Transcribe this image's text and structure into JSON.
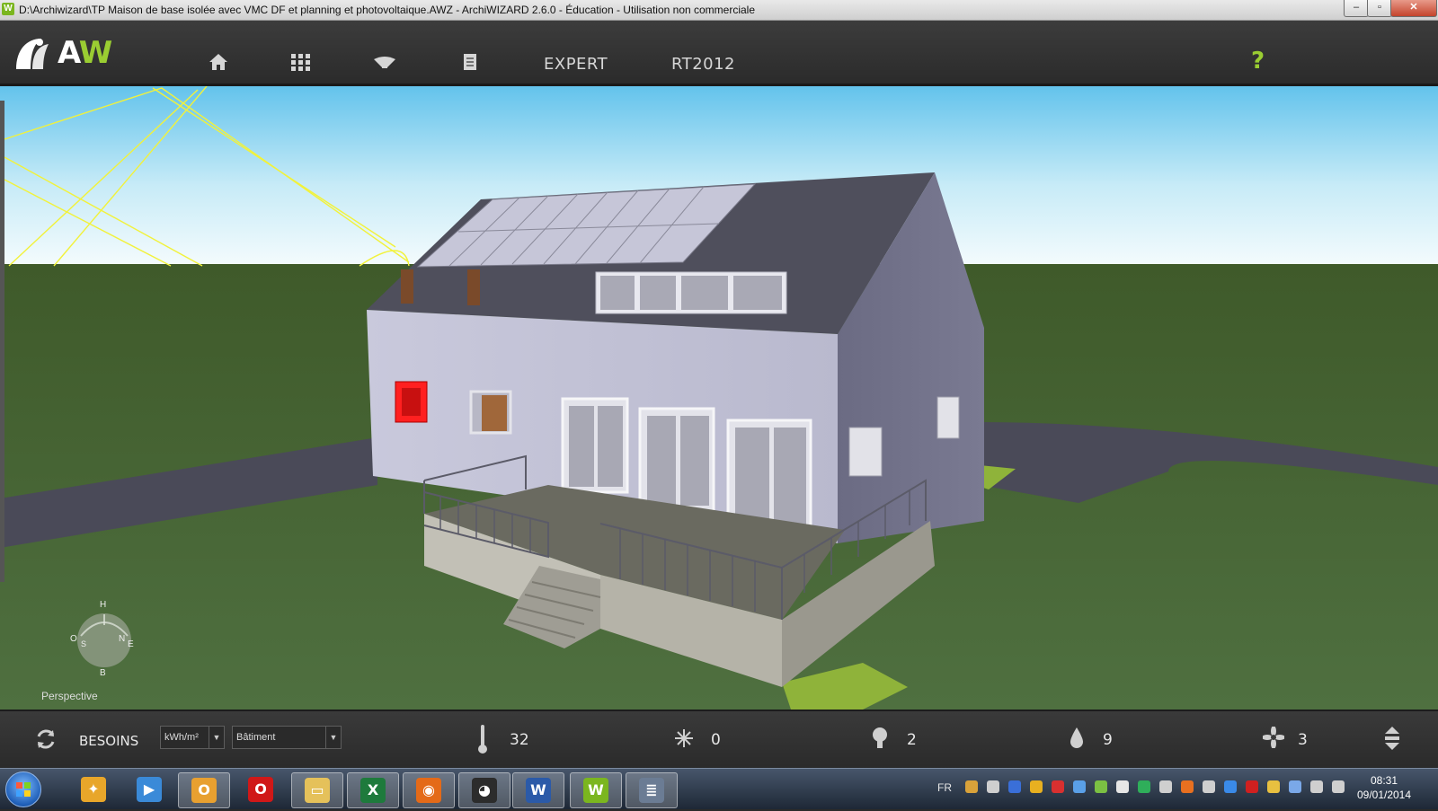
{
  "window": {
    "app_icon_letter": "W",
    "title": "D:\\Archiwizard\\TP Maison de base isolée avec VMC DF et planning et photovoltaique.AWZ  -  ArchiWIZARD 2.6.0 - Éducation - Utilisation non commerciale",
    "minimize": "–",
    "maximize": "▫",
    "close": "✕"
  },
  "header": {
    "logo_text_a": "A",
    "logo_text_w": "W",
    "nav": [
      {
        "name": "home-icon"
      },
      {
        "name": "grid-icon"
      },
      {
        "name": "view-icon"
      },
      {
        "name": "document-icon"
      }
    ],
    "expert_label": "EXPERT",
    "rt2012_label": "RT2012",
    "help_label": "?",
    "accent_color": "#9acd32"
  },
  "viewport": {
    "compass": {
      "top": "H",
      "bottom": "B",
      "left": "O",
      "south": "S",
      "north": "N",
      "east": "E"
    },
    "view_mode": "Perspective"
  },
  "statusbar": {
    "refresh_icon": "refresh-icon",
    "besoins_label": "BESOINS",
    "unit_select": "kWh/m²",
    "scope_select": "Bâtiment",
    "metrics": [
      {
        "icon": "thermometer-icon",
        "value": "32"
      },
      {
        "icon": "snowflake-icon",
        "value": "0"
      },
      {
        "icon": "lightbulb-icon",
        "value": "2"
      },
      {
        "icon": "drop-icon",
        "value": "9"
      },
      {
        "icon": "fan-icon",
        "value": "3"
      }
    ],
    "expand_icon": "expand-icon"
  },
  "taskbar": {
    "apps": [
      {
        "name": "paint-app",
        "glyph": "✦",
        "color": "#e8a62a"
      },
      {
        "name": "media-player-app",
        "glyph": "▶",
        "color": "#3a8ad8"
      },
      {
        "name": "outlook-app",
        "glyph": "O",
        "color": "#e8a030"
      },
      {
        "name": "opera-app",
        "glyph": "O",
        "color": "#d01818"
      },
      {
        "name": "explorer-app",
        "glyph": "▭",
        "color": "#e5c15a"
      },
      {
        "name": "excel-app",
        "glyph": "X",
        "color": "#1e7a3c"
      },
      {
        "name": "firefox-app",
        "glyph": "◉",
        "color": "#e46a18"
      },
      {
        "name": "user-app",
        "glyph": "◕",
        "color": "#2c2c2c"
      },
      {
        "name": "word-app",
        "glyph": "W",
        "color": "#2b5aa8"
      },
      {
        "name": "archiwizard-app",
        "glyph": "W",
        "color": "#7bb61f"
      },
      {
        "name": "notes-app",
        "glyph": "≣",
        "color": "#6b7c94"
      }
    ],
    "language": "FR",
    "time": "08:31",
    "date": "09/01/2014"
  }
}
